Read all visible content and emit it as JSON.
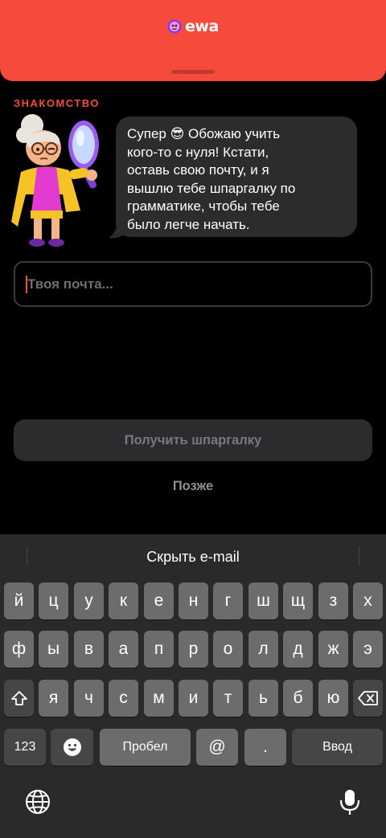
{
  "header": {
    "logo_text": "ewa",
    "brand_color": "#f54a3c",
    "logo_icon": "ewa-logo-icon"
  },
  "chat": {
    "section_label": "ЗНАКОМСТВО",
    "character_icon": "grandma-detective-character",
    "message_lines": [
      "Супер 😎 Обожаю учить",
      "кого-то с нуля! Кстати,",
      "оставь свою почту, и я",
      "вышлю тебе шпаргалку по",
      "грамматике, чтобы тебе",
      "было легче начать."
    ]
  },
  "form": {
    "email_placeholder": "Твоя почта...",
    "email_value": "",
    "submit_label": "Получить шпаргалку",
    "later_label": "Позже"
  },
  "keyboard": {
    "suggestion": "Скрыть e-mail",
    "row1": [
      "й",
      "ц",
      "у",
      "к",
      "е",
      "н",
      "г",
      "ш",
      "щ",
      "з",
      "х"
    ],
    "row2": [
      "ф",
      "ы",
      "в",
      "а",
      "п",
      "р",
      "о",
      "л",
      "д",
      "ж",
      "э"
    ],
    "row3": [
      "я",
      "ч",
      "с",
      "м",
      "и",
      "т",
      "ь",
      "б",
      "ю"
    ],
    "numbers_key": "123",
    "space_key": "Пробел",
    "at_key": "@",
    "dot_key": ".",
    "return_key": "Ввод",
    "shift_icon": "shift-icon",
    "backspace_icon": "backspace-icon",
    "emoji_icon": "emoji-icon",
    "globe_icon": "globe-icon",
    "mic_icon": "microphone-icon"
  }
}
